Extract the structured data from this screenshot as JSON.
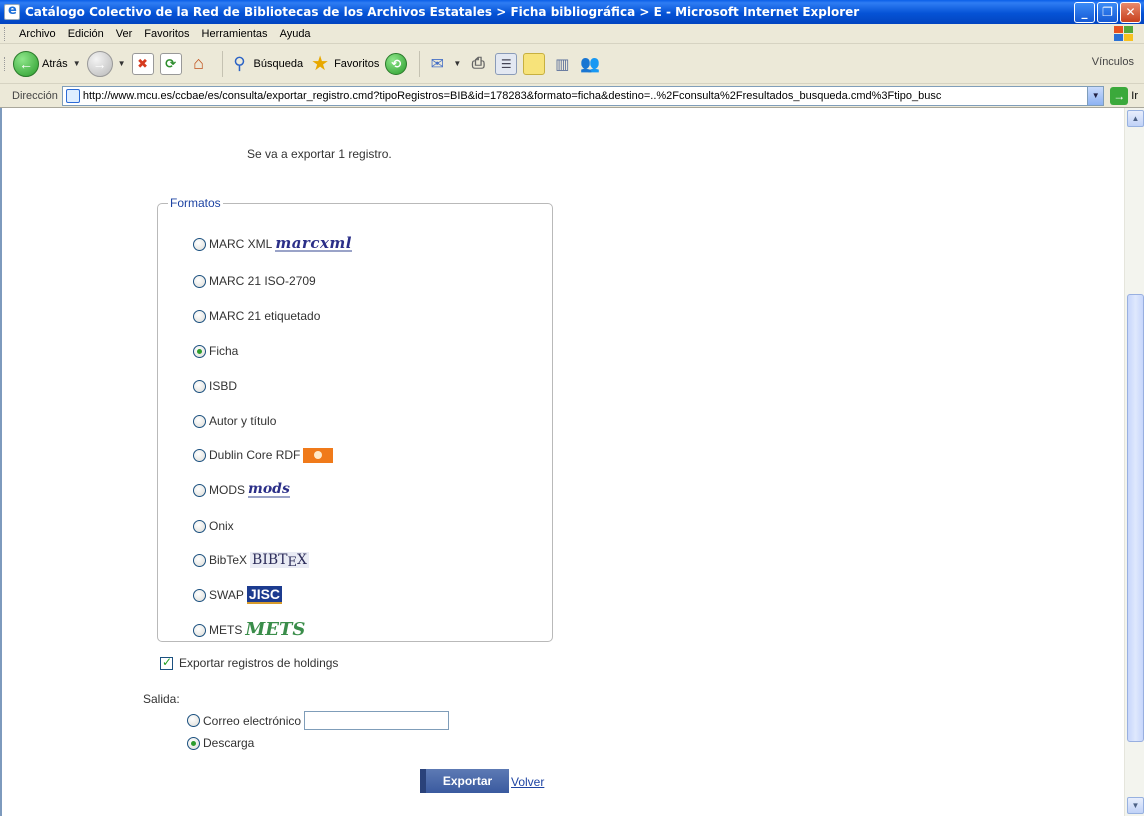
{
  "window": {
    "title": "Catálogo Colectivo de la Red de Bibliotecas de los Archivos Estatales > Ficha bibliográfica > E - Microsoft Internet Explorer"
  },
  "menubar": {
    "items": [
      "Archivo",
      "Edición",
      "Ver",
      "Favoritos",
      "Herramientas",
      "Ayuda"
    ]
  },
  "toolbar": {
    "back_label": "Atrás",
    "search_label": "Búsqueda",
    "favorites_label": "Favoritos",
    "links_label": "Vínculos"
  },
  "addressbar": {
    "label": "Dirección",
    "url": "http://www.mcu.es/ccbae/es/consulta/exportar_registro.cmd?tipoRegistros=BIB&id=178283&formato=ficha&destino=..%2Fconsulta%2Fresultados_busqueda.cmd%3Ftipo_busc",
    "go_label": "Ir"
  },
  "page": {
    "info": "Se va a exportar 1 registro.",
    "formats_legend": "Formatos",
    "formats": [
      {
        "label": "MARC XML",
        "logo": "MARCXML",
        "checked": false
      },
      {
        "label": "MARC 21 ISO-2709",
        "logo": "",
        "checked": false
      },
      {
        "label": "MARC 21 etiquetado",
        "logo": "",
        "checked": false
      },
      {
        "label": "Ficha",
        "logo": "",
        "checked": true
      },
      {
        "label": "ISBD",
        "logo": "",
        "checked": false
      },
      {
        "label": "Autor y título",
        "logo": "",
        "checked": false
      },
      {
        "label": "Dublin Core RDF",
        "logo": "",
        "checked": false
      },
      {
        "label": "MODS",
        "logo": "MODS",
        "checked": false
      },
      {
        "label": "Onix",
        "logo": "",
        "checked": false
      },
      {
        "label": "BibTeX",
        "logo": "BIBTEX",
        "checked": false
      },
      {
        "label": "SWAP",
        "logo": "JISC",
        "checked": false
      },
      {
        "label": "METS",
        "logo": "METS",
        "checked": false
      }
    ],
    "holdings_label": "Exportar registros de holdings",
    "holdings_checked": true,
    "output_label": "Salida:",
    "output_options": [
      {
        "label": "Correo electrónico",
        "checked": false
      },
      {
        "label": "Descarga",
        "checked": true
      }
    ],
    "export_button": "Exportar",
    "back_link": "Volver"
  }
}
